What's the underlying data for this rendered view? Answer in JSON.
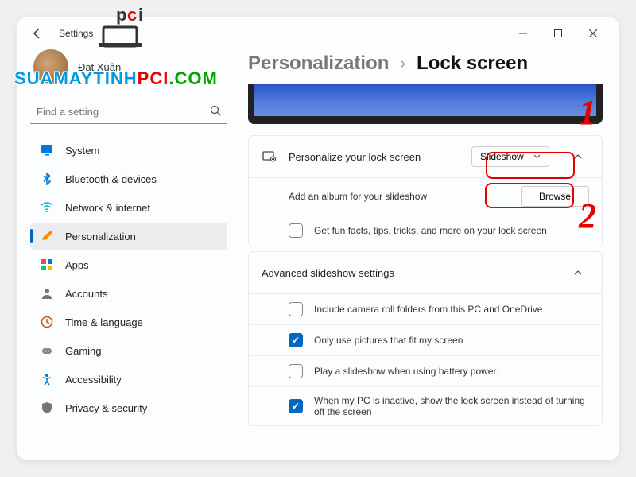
{
  "app": {
    "title": "Settings"
  },
  "user": {
    "name": "Đạt Xuân"
  },
  "search": {
    "placeholder": "Find a setting"
  },
  "nav": {
    "items": [
      {
        "label": "System"
      },
      {
        "label": "Bluetooth & devices"
      },
      {
        "label": "Network & internet"
      },
      {
        "label": "Personalization"
      },
      {
        "label": "Apps"
      },
      {
        "label": "Accounts"
      },
      {
        "label": "Time & language"
      },
      {
        "label": "Gaming"
      },
      {
        "label": "Accessibility"
      },
      {
        "label": "Privacy & security"
      }
    ]
  },
  "breadcrumb": {
    "parent": "Personalization",
    "sep": "›",
    "current": "Lock screen"
  },
  "lockscreen": {
    "title": "Personalize your lock screen",
    "dropdown_value": "Slideshow",
    "add_album": "Add an album for your slideshow",
    "browse": "Browse",
    "funfacts": "Get fun facts, tips, tricks, and more on your lock screen"
  },
  "advanced": {
    "title": "Advanced slideshow settings",
    "options": [
      {
        "label": "Include camera roll folders from this PC and OneDrive",
        "checked": false
      },
      {
        "label": "Only use pictures that fit my screen",
        "checked": true
      },
      {
        "label": "Play a slideshow when using battery power",
        "checked": false
      },
      {
        "label": "When my PC is inactive, show the lock screen instead of turning off the screen",
        "checked": true
      }
    ]
  },
  "watermark": {
    "part1": "SUAMAYTINH",
    "part2": "PCI",
    "part3": ".COM"
  },
  "annotations": {
    "one": "1",
    "two": "2"
  }
}
